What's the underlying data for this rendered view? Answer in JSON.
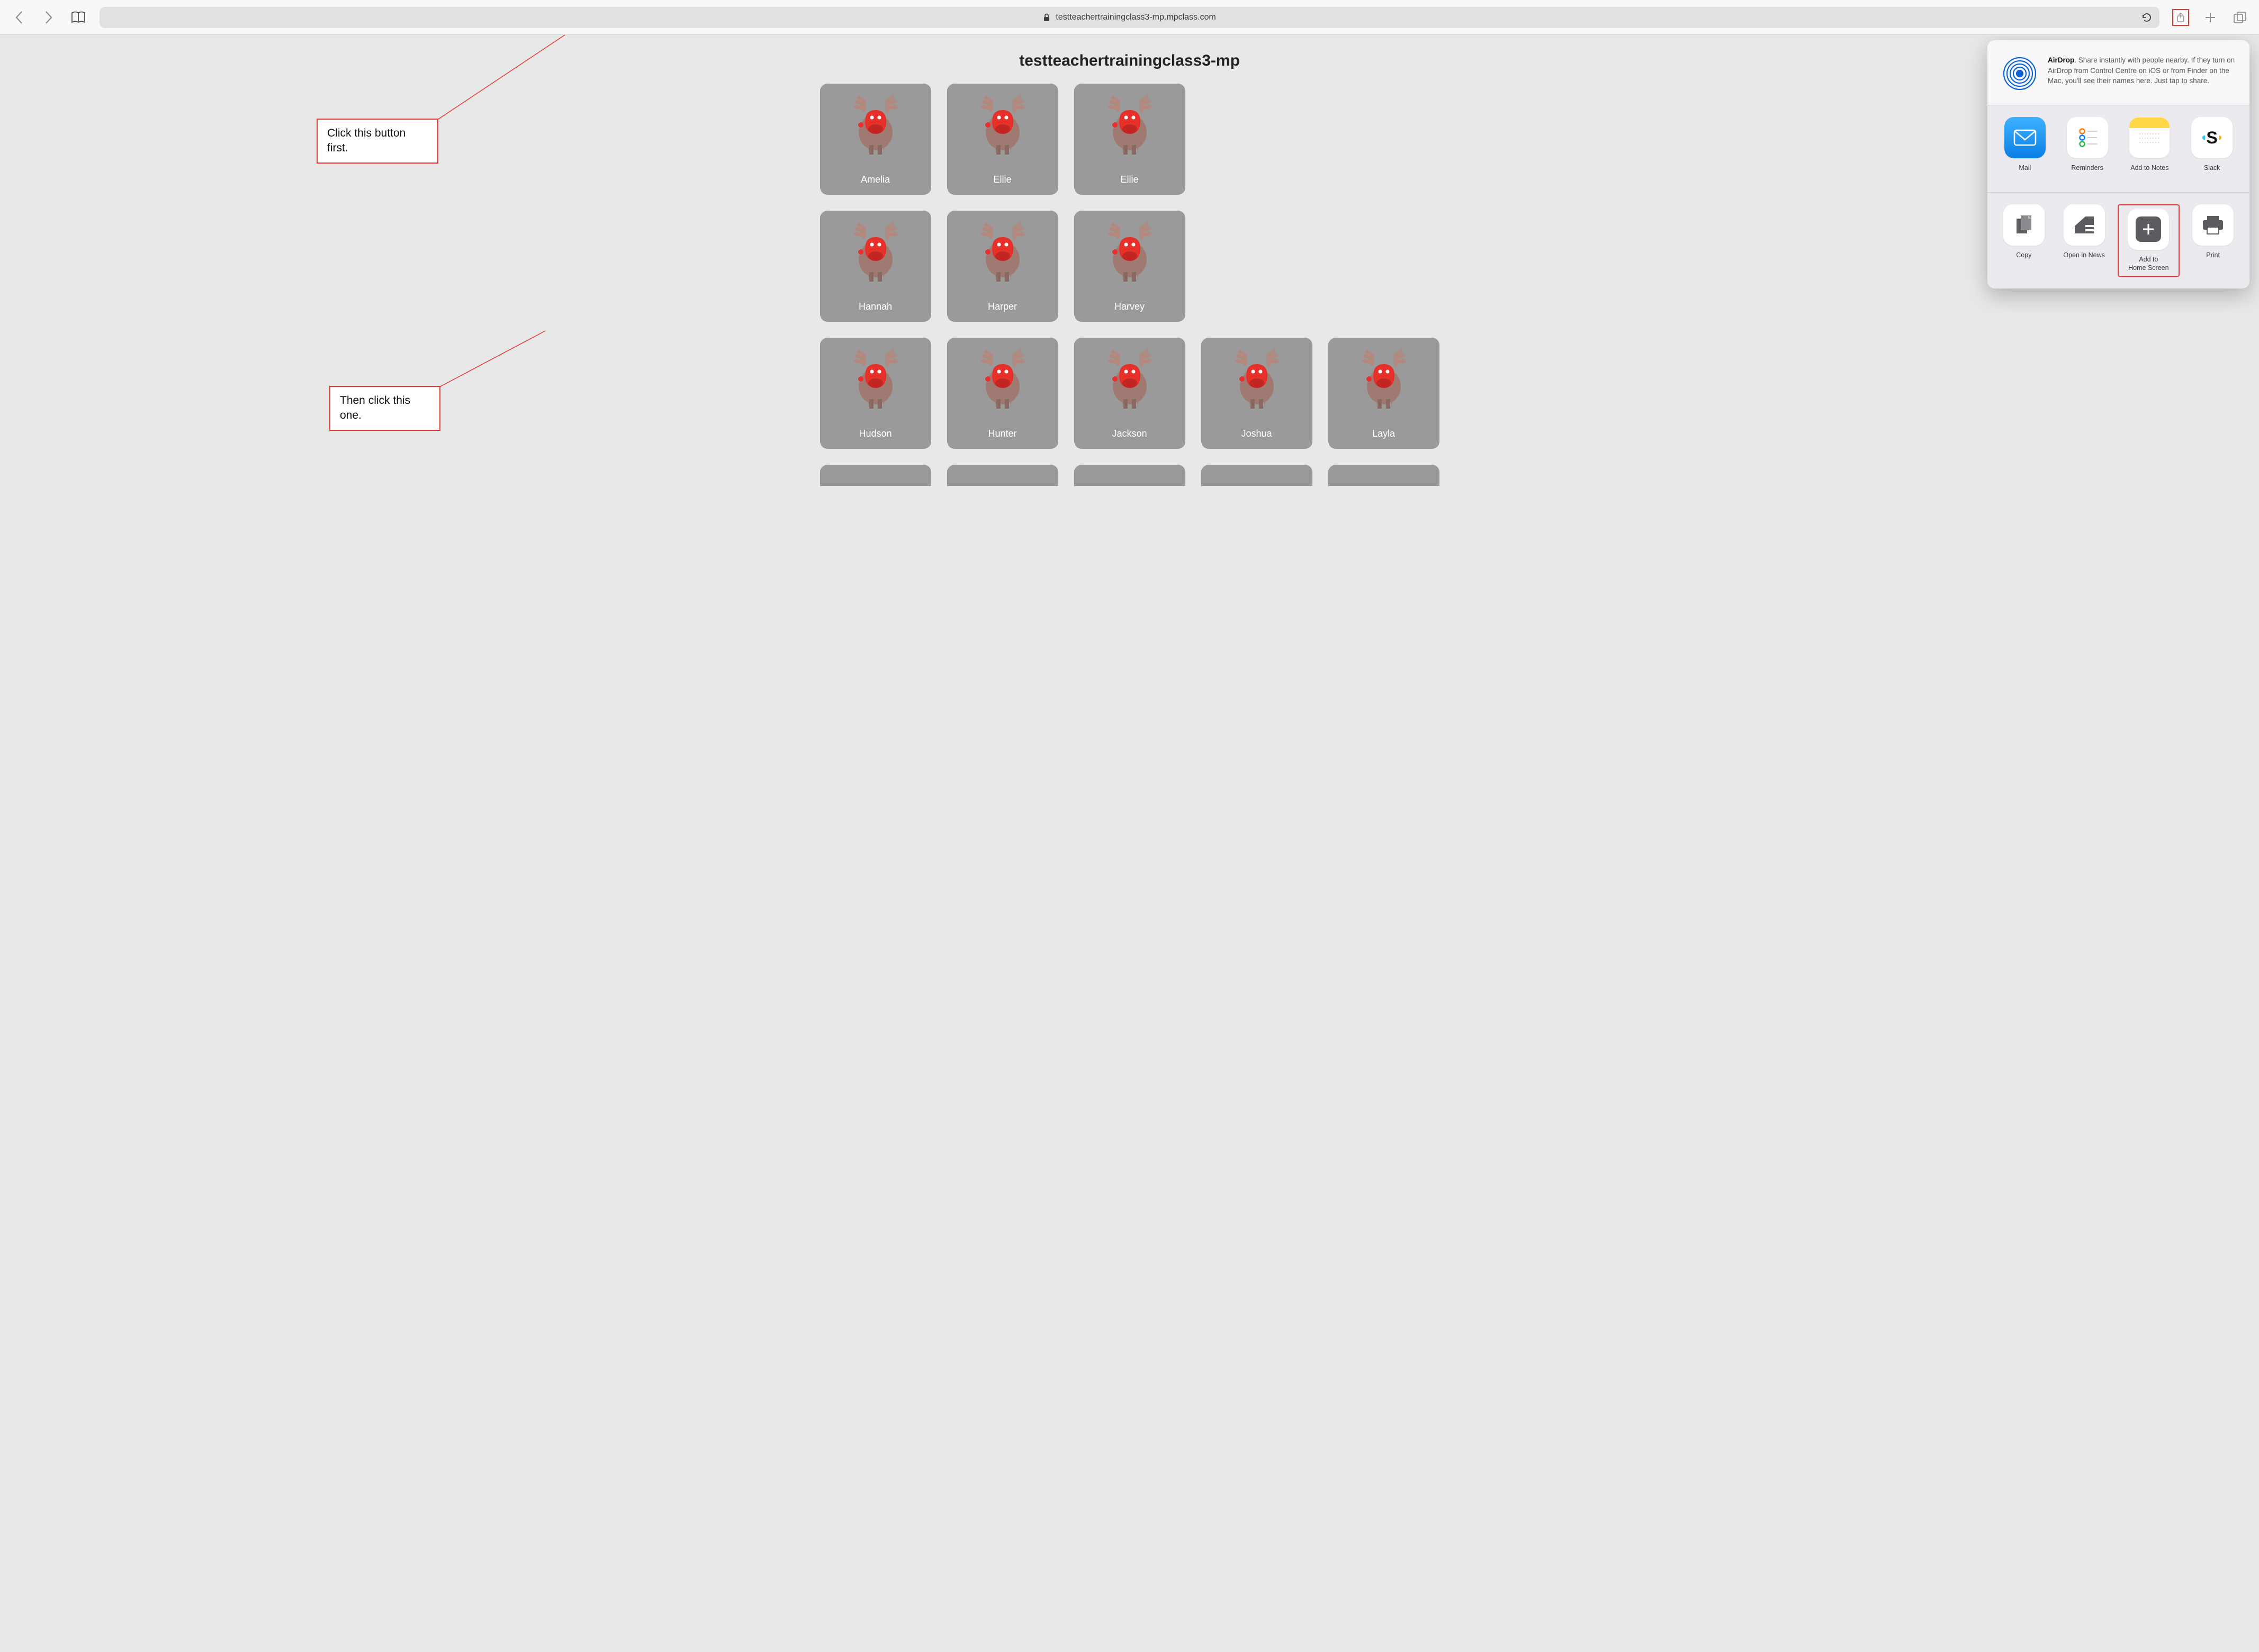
{
  "toolbar": {
    "url": "testteachertrainingclass3-mp.mpclass.com",
    "icons": {
      "back": "back-icon",
      "forward": "forward-icon",
      "bookmarks": "book-icon",
      "lock": "lock-icon",
      "reload": "reload-icon",
      "share": "share-icon",
      "newtab": "plus-icon",
      "tabs": "tabs-icon"
    }
  },
  "page": {
    "title": "testteachertrainingclass3-mp",
    "students": [
      "Amelia",
      "Ellie",
      "Ellie",
      "Hannah",
      "Harper",
      "Harvey",
      "Hudson",
      "Hunter",
      "Jackson",
      "Joshua",
      "Layla"
    ]
  },
  "share_sheet": {
    "airdrop": {
      "label_bold": "AirDrop",
      "text": ". Share instantly with people nearby. If they turn on AirDrop from Control Centre on iOS or from Finder on the Mac, you'll see their names here. Just tap to share."
    },
    "apps": [
      {
        "id": "mail",
        "label": "Mail"
      },
      {
        "id": "reminders",
        "label": "Reminders"
      },
      {
        "id": "notes",
        "label": "Add to Notes"
      },
      {
        "id": "slack",
        "label": "Slack"
      }
    ],
    "actions": [
      {
        "id": "copy",
        "label": "Copy"
      },
      {
        "id": "open-in-news",
        "label": "Open in News"
      },
      {
        "id": "add-home",
        "label": "Add to\nHome Screen"
      },
      {
        "id": "print",
        "label": "Print"
      }
    ]
  },
  "annotations": {
    "callout1": "Click this button first.",
    "callout2": "Then click this one."
  },
  "colors": {
    "annotation_red": "#e53935",
    "card_bg": "#9a9a9a"
  }
}
